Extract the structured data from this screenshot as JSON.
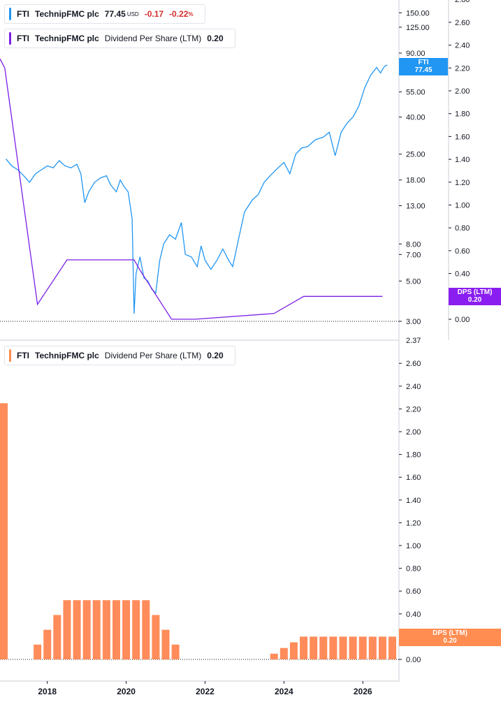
{
  "legend_price": {
    "ticker": "FTI",
    "name": "TechnipFMC plc",
    "price": "77.45",
    "currency": "USD",
    "change": "-0.17",
    "change_pct": "-0.22",
    "pct_symbol": "%",
    "color": "#2196f3"
  },
  "legend_dps_top": {
    "ticker": "FTI",
    "name": "TechnipFMC plc",
    "metric": "Dividend Per Share (LTM)",
    "value": "0.20",
    "color": "#7b1fe6"
  },
  "legend_dps_bottom": {
    "ticker": "FTI",
    "name": "TechnipFMC plc",
    "metric": "Dividend Per Share (LTM)",
    "value": "0.20",
    "color": "#ff8c50"
  },
  "badges": {
    "price": {
      "line1": "FTI",
      "line2": "77.45",
      "color": "#2196f3"
    },
    "dps_top": {
      "line1": "DPS (LTM)",
      "line2": "0.20",
      "color": "#8a1ef0"
    },
    "dps_bottom": {
      "line1": "DPS (LTM)",
      "line2": "0.20",
      "color": "#ff8c50"
    }
  },
  "chart_data": [
    {
      "type": "line",
      "series": [
        {
          "name": "FTI",
          "color": "#2196f3",
          "points": [
            [
              2016.95,
              23.5
            ],
            [
              2017.1,
              21.5
            ],
            [
              2017.25,
              20.5
            ],
            [
              2017.4,
              19
            ],
            [
              2017.55,
              17.5
            ],
            [
              2017.7,
              19.5
            ],
            [
              2017.85,
              20.5
            ],
            [
              2018.0,
              21.5
            ],
            [
              2018.15,
              21.0
            ],
            [
              2018.3,
              23.0
            ],
            [
              2018.45,
              21.5
            ],
            [
              2018.6,
              21.0
            ],
            [
              2018.75,
              22.0
            ],
            [
              2018.85,
              19.5
            ],
            [
              2018.95,
              13.5
            ],
            [
              2019.05,
              15.5
            ],
            [
              2019.2,
              17.5
            ],
            [
              2019.35,
              18.5
            ],
            [
              2019.5,
              19.0
            ],
            [
              2019.6,
              17.0
            ],
            [
              2019.75,
              15.5
            ],
            [
              2019.85,
              18.0
            ],
            [
              2019.95,
              16.5
            ],
            [
              2020.05,
              15.5
            ],
            [
              2020.15,
              11.0
            ],
            [
              2020.2,
              3.3
            ],
            [
              2020.25,
              5.5
            ],
            [
              2020.35,
              6.8
            ],
            [
              2020.45,
              5.2
            ],
            [
              2020.55,
              5.0
            ],
            [
              2020.65,
              4.5
            ],
            [
              2020.75,
              4.3
            ],
            [
              2020.85,
              6.5
            ],
            [
              2020.95,
              8.0
            ],
            [
              2021.1,
              9.0
            ],
            [
              2021.25,
              8.5
            ],
            [
              2021.4,
              10.5
            ],
            [
              2021.5,
              7.0
            ],
            [
              2021.65,
              6.8
            ],
            [
              2021.8,
              6.0
            ],
            [
              2021.9,
              7.8
            ],
            [
              2022.0,
              6.5
            ],
            [
              2022.15,
              5.8
            ],
            [
              2022.3,
              6.5
            ],
            [
              2022.45,
              7.5
            ],
            [
              2022.6,
              6.5
            ],
            [
              2022.7,
              6.0
            ],
            [
              2022.85,
              8.5
            ],
            [
              2023.0,
              12.0
            ],
            [
              2023.2,
              14.0
            ],
            [
              2023.35,
              15.0
            ],
            [
              2023.5,
              17.5
            ],
            [
              2023.65,
              19.0
            ],
            [
              2023.85,
              21.0
            ],
            [
              2024.0,
              22.5
            ],
            [
              2024.15,
              19.5
            ],
            [
              2024.3,
              25.0
            ],
            [
              2024.45,
              27.0
            ],
            [
              2024.6,
              27.5
            ],
            [
              2024.8,
              30.0
            ],
            [
              2025.0,
              31.0
            ],
            [
              2025.15,
              33.0
            ],
            [
              2025.3,
              24.5
            ],
            [
              2025.45,
              33.0
            ],
            [
              2025.6,
              37.0
            ],
            [
              2025.75,
              40.0
            ],
            [
              2025.9,
              46.0
            ],
            [
              2026.05,
              58.0
            ],
            [
              2026.2,
              68.0
            ],
            [
              2026.35,
              75.0
            ],
            [
              2026.45,
              70.0
            ],
            [
              2026.55,
              76.0
            ],
            [
              2026.62,
              77.45
            ]
          ]
        }
      ],
      "y_ticks": [
        "150.00",
        "125.00",
        "90.00",
        "55.00",
        "40.00",
        "25.00",
        "18.00",
        "13.00",
        "8.00",
        "7.00",
        "5.00",
        "3.00"
      ],
      "y_scale": "log"
    },
    {
      "type": "line",
      "series": [
        {
          "name": "DPS (LTM)",
          "color": "#7b1fe6",
          "points": [
            [
              2016.8,
              2.28
            ],
            [
              2016.92,
              2.2
            ],
            [
              2017.75,
              0.13
            ],
            [
              2018.5,
              0.52
            ],
            [
              2020.2,
              0.52
            ],
            [
              2020.35,
              0.43
            ],
            [
              2021.15,
              0.0
            ],
            [
              2021.75,
              0.0
            ],
            [
              2023.75,
              0.05
            ],
            [
              2024.5,
              0.2
            ],
            [
              2026.5,
              0.2
            ]
          ]
        }
      ],
      "y_ticks": [
        "2.80",
        "2.60",
        "2.40",
        "2.20",
        "2.00",
        "1.80",
        "1.60",
        "1.40",
        "1.20",
        "1.00",
        "0.80",
        "0.60",
        "0.40",
        "0.20",
        "0.00"
      ]
    },
    {
      "type": "bar",
      "series": [
        {
          "name": "Dividend Per Share (LTM)",
          "color": "#ff8c5a",
          "values": [
            2.25,
            0.13,
            0.26,
            0.39,
            0.52,
            0.52,
            0.52,
            0.52,
            0.52,
            0.52,
            0.52,
            0.52,
            0.52,
            0.39,
            0.26,
            0.13,
            0.05,
            0.1,
            0.15,
            0.2,
            0.2,
            0.2,
            0.2,
            0.2,
            0.2,
            0.2,
            0.2,
            0.2,
            0.2
          ]
        }
      ],
      "x": [
        2016.8,
        2017.75,
        2018.0,
        2018.25,
        2018.5,
        2018.75,
        2019.0,
        2019.25,
        2019.5,
        2019.75,
        2020.0,
        2020.25,
        2020.5,
        2020.75,
        2021.0,
        2021.25,
        2023.75,
        2024.0,
        2024.25,
        2024.5,
        2024.75,
        2025.0,
        2025.25,
        2025.5,
        2025.75,
        2026.0,
        2026.25,
        2026.5,
        2026.75
      ],
      "y_ticks": [
        "2.60",
        "2.40",
        "2.20",
        "2.00",
        "1.80",
        "1.60",
        "1.40",
        "1.20",
        "1.00",
        "0.80",
        "0.60",
        "0.40",
        "0.20",
        "0.00"
      ],
      "y_top": "2.37",
      "ylim": [
        0,
        2.6
      ]
    }
  ],
  "x_axis": {
    "labels": [
      "2018",
      "2020",
      "2022",
      "2024",
      "2026"
    ],
    "values": [
      2018,
      2020,
      2022,
      2024,
      2026
    ]
  }
}
